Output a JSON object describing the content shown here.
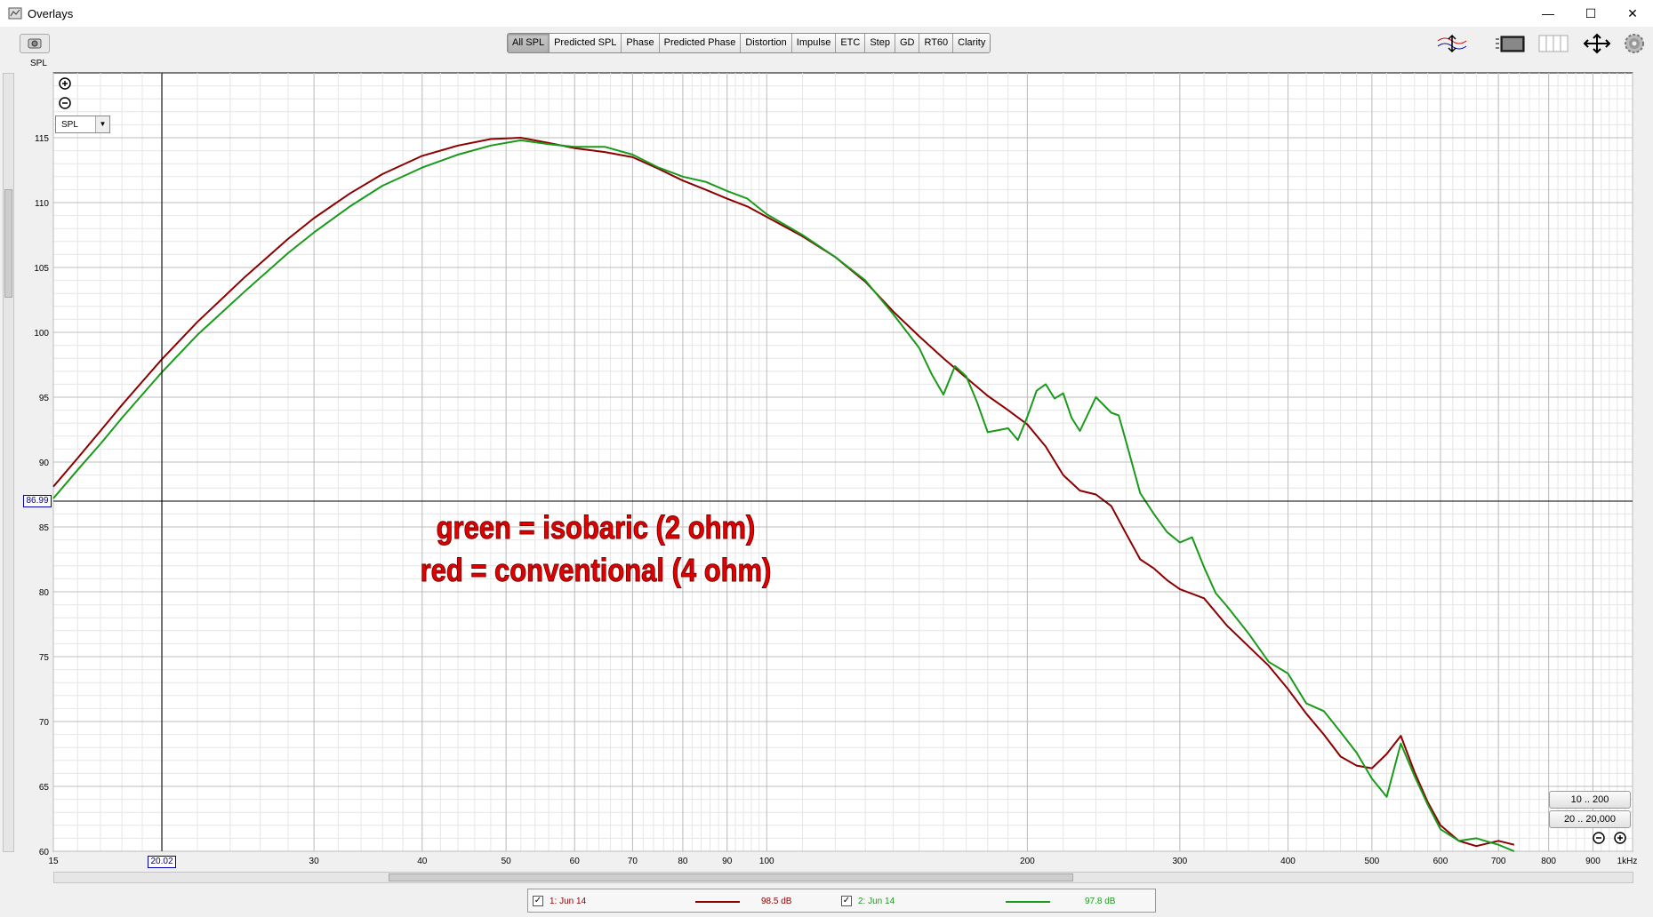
{
  "window": {
    "title": "Overlays",
    "minimize": "—",
    "maximize": "☐",
    "close": "✕"
  },
  "toolbar": {
    "spl_label": "SPL",
    "tabs": [
      "All SPL",
      "Predicted SPL",
      "Phase",
      "Predicted Phase",
      "Distortion",
      "Impulse",
      "ETC",
      "Step",
      "GD",
      "RT60",
      "Clarity"
    ],
    "active_tab": "All SPL",
    "icons": [
      "overlay-icon",
      "panel-icon",
      "columns-icon",
      "arrows-icon",
      "settings-icon"
    ]
  },
  "plot": {
    "view_select": "SPL",
    "y_cursor_readout": "86.99",
    "x_cursor_readout": "20.02",
    "range_buttons": [
      "10 .. 200",
      "20 .. 20,000"
    ],
    "annotation": [
      "green = isobaric (2 ohm)",
      "red = conventional (4 ohm)"
    ]
  },
  "legend": {
    "entries": [
      {
        "label": "1: Jun 14",
        "value": "98.5 dB",
        "color": "#8b0000",
        "checked": true
      },
      {
        "label": "2: Jun 14",
        "value": "97.8 dB",
        "color": "#1a9a1a",
        "checked": true
      }
    ]
  },
  "chart_data": {
    "type": "line",
    "xlabel": "",
    "ylabel": "",
    "x_scale": "log",
    "xlim": [
      15,
      1000
    ],
    "ylim": [
      60,
      120
    ],
    "x_ticks": [
      {
        "v": 15,
        "t": "15"
      },
      {
        "v": 30,
        "t": "30"
      },
      {
        "v": 40,
        "t": "40"
      },
      {
        "v": 50,
        "t": "50"
      },
      {
        "v": 60,
        "t": "60"
      },
      {
        "v": 70,
        "t": "70"
      },
      {
        "v": 80,
        "t": "80"
      },
      {
        "v": 90,
        "t": "90"
      },
      {
        "v": 100,
        "t": "100"
      },
      {
        "v": 200,
        "t": "200"
      },
      {
        "v": 300,
        "t": "300"
      },
      {
        "v": 400,
        "t": "400"
      },
      {
        "v": 500,
        "t": "500"
      },
      {
        "v": 600,
        "t": "600"
      },
      {
        "v": 700,
        "t": "700"
      },
      {
        "v": 800,
        "t": "800"
      },
      {
        "v": 900,
        "t": "900"
      },
      {
        "v": 1000,
        "t": "1kHz"
      }
    ],
    "y_ticks": [
      60,
      65,
      70,
      75,
      80,
      85,
      90,
      95,
      100,
      105,
      110,
      115
    ],
    "grid": true,
    "cursor": {
      "x": 20.02,
      "y": 86.99
    },
    "series": [
      {
        "name": "1: Jun 14",
        "color": "#8b0000",
        "points": [
          [
            15,
            88.1
          ],
          [
            16,
            90.3
          ],
          [
            17,
            92.4
          ],
          [
            18,
            94.4
          ],
          [
            19,
            96.2
          ],
          [
            20,
            97.9
          ],
          [
            22,
            100.8
          ],
          [
            25,
            104.3
          ],
          [
            28,
            107.2
          ],
          [
            30,
            108.8
          ],
          [
            33,
            110.7
          ],
          [
            36,
            112.2
          ],
          [
            40,
            113.6
          ],
          [
            44,
            114.4
          ],
          [
            48,
            114.9
          ],
          [
            52,
            115.0
          ],
          [
            56,
            114.6
          ],
          [
            60,
            114.2
          ],
          [
            65,
            113.9
          ],
          [
            70,
            113.5
          ],
          [
            75,
            112.6
          ],
          [
            80,
            111.7
          ],
          [
            85,
            111.0
          ],
          [
            90,
            110.3
          ],
          [
            95,
            109.7
          ],
          [
            100,
            108.9
          ],
          [
            110,
            107.4
          ],
          [
            120,
            105.8
          ],
          [
            130,
            103.9
          ],
          [
            140,
            101.6
          ],
          [
            150,
            99.7
          ],
          [
            160,
            98.0
          ],
          [
            170,
            96.5
          ],
          [
            180,
            95.1
          ],
          [
            190,
            94.0
          ],
          [
            200,
            92.9
          ],
          [
            210,
            91.2
          ],
          [
            220,
            89.0
          ],
          [
            230,
            87.8
          ],
          [
            240,
            87.5
          ],
          [
            250,
            86.6
          ],
          [
            260,
            84.5
          ],
          [
            270,
            82.5
          ],
          [
            280,
            81.8
          ],
          [
            290,
            80.9
          ],
          [
            300,
            80.2
          ],
          [
            320,
            79.5
          ],
          [
            340,
            77.4
          ],
          [
            360,
            75.8
          ],
          [
            380,
            74.3
          ],
          [
            400,
            72.5
          ],
          [
            420,
            70.6
          ],
          [
            440,
            69.0
          ],
          [
            460,
            67.3
          ],
          [
            480,
            66.6
          ],
          [
            500,
            66.4
          ],
          [
            520,
            67.5
          ],
          [
            540,
            68.9
          ],
          [
            560,
            66.1
          ],
          [
            580,
            63.8
          ],
          [
            600,
            62.0
          ],
          [
            630,
            60.8
          ],
          [
            660,
            60.4
          ],
          [
            700,
            60.8
          ],
          [
            730,
            60.5
          ]
        ]
      },
      {
        "name": "2: Jun 14",
        "color": "#1a9a1a",
        "points": [
          [
            15,
            87.2
          ],
          [
            16,
            89.4
          ],
          [
            17,
            91.4
          ],
          [
            18,
            93.4
          ],
          [
            19,
            95.2
          ],
          [
            20,
            96.9
          ],
          [
            22,
            99.8
          ],
          [
            25,
            103.2
          ],
          [
            28,
            106.1
          ],
          [
            30,
            107.7
          ],
          [
            33,
            109.7
          ],
          [
            36,
            111.3
          ],
          [
            40,
            112.7
          ],
          [
            44,
            113.7
          ],
          [
            48,
            114.4
          ],
          [
            52,
            114.8
          ],
          [
            56,
            114.5
          ],
          [
            60,
            114.3
          ],
          [
            65,
            114.3
          ],
          [
            70,
            113.7
          ],
          [
            75,
            112.7
          ],
          [
            80,
            112.0
          ],
          [
            85,
            111.6
          ],
          [
            90,
            110.9
          ],
          [
            95,
            110.3
          ],
          [
            100,
            109.1
          ],
          [
            110,
            107.5
          ],
          [
            120,
            105.8
          ],
          [
            130,
            104.0
          ],
          [
            140,
            101.4
          ],
          [
            150,
            98.8
          ],
          [
            155,
            96.8
          ],
          [
            160,
            95.2
          ],
          [
            165,
            97.4
          ],
          [
            170,
            96.6
          ],
          [
            175,
            94.6
          ],
          [
            180,
            92.3
          ],
          [
            190,
            92.6
          ],
          [
            195,
            91.7
          ],
          [
            200,
            93.5
          ],
          [
            205,
            95.5
          ],
          [
            210,
            96.0
          ],
          [
            215,
            94.9
          ],
          [
            220,
            95.3
          ],
          [
            225,
            93.4
          ],
          [
            230,
            92.4
          ],
          [
            240,
            95.0
          ],
          [
            250,
            93.8
          ],
          [
            255,
            93.6
          ],
          [
            260,
            91.6
          ],
          [
            270,
            87.6
          ],
          [
            280,
            86.0
          ],
          [
            290,
            84.6
          ],
          [
            300,
            83.8
          ],
          [
            310,
            84.2
          ],
          [
            320,
            81.9
          ],
          [
            330,
            79.9
          ],
          [
            340,
            78.9
          ],
          [
            360,
            76.8
          ],
          [
            380,
            74.6
          ],
          [
            400,
            73.7
          ],
          [
            420,
            71.4
          ],
          [
            440,
            70.8
          ],
          [
            460,
            69.2
          ],
          [
            480,
            67.6
          ],
          [
            500,
            65.6
          ],
          [
            520,
            64.2
          ],
          [
            540,
            68.3
          ],
          [
            560,
            65.8
          ],
          [
            580,
            63.6
          ],
          [
            600,
            61.7
          ],
          [
            630,
            60.8
          ],
          [
            660,
            61.0
          ],
          [
            700,
            60.5
          ],
          [
            730,
            60.0
          ]
        ]
      }
    ]
  }
}
